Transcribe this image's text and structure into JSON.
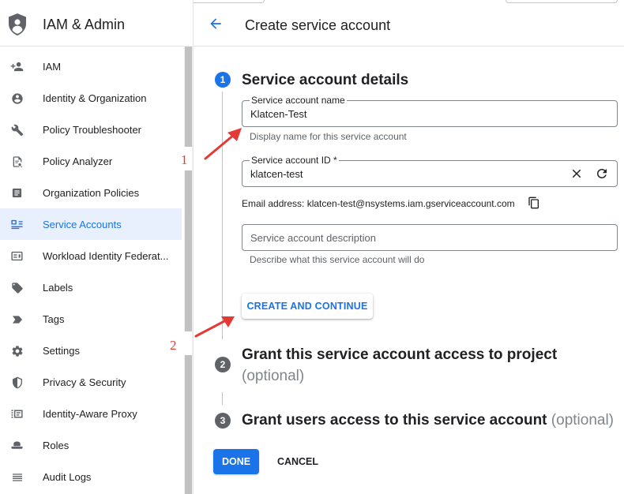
{
  "app": {
    "title": "IAM & Admin"
  },
  "sidebar": {
    "items": [
      {
        "label": "IAM",
        "icon": "person-add-icon"
      },
      {
        "label": "Identity & Organization",
        "icon": "account-circle-icon"
      },
      {
        "label": "Policy Troubleshooter",
        "icon": "wrench-icon"
      },
      {
        "label": "Policy Analyzer",
        "icon": "document-search-icon"
      },
      {
        "label": "Organization Policies",
        "icon": "list-document-icon"
      },
      {
        "label": "Service Accounts",
        "icon": "service-account-icon",
        "active": true
      },
      {
        "label": "Workload Identity Federat...",
        "icon": "id-card-icon"
      },
      {
        "label": "Labels",
        "icon": "label-tag-icon"
      },
      {
        "label": "Tags",
        "icon": "tag-chevron-icon"
      },
      {
        "label": "Settings",
        "icon": "gear-icon"
      },
      {
        "label": "Privacy & Security",
        "icon": "shield-icon"
      },
      {
        "label": "Identity-Aware Proxy",
        "icon": "proxy-icon"
      },
      {
        "label": "Roles",
        "icon": "hat-icon"
      },
      {
        "label": "Audit Logs",
        "icon": "list-lines-icon"
      }
    ]
  },
  "header": {
    "title": "Create service account"
  },
  "steps": {
    "step1": {
      "number": "1",
      "title": "Service account details",
      "name_field": {
        "label": "Service account name",
        "value": "Klatcen-Test",
        "helper": "Display name for this service account"
      },
      "id_field": {
        "label": "Service account ID *",
        "value": "klatcen-test"
      },
      "email": "Email address: klatcen-test@nsystems.iam.gserviceaccount.com",
      "description_field": {
        "placeholder": "Service account description",
        "helper": "Describe what this service account will do"
      },
      "continue_label": "CREATE AND CONTINUE"
    },
    "step2": {
      "number": "2",
      "title": "Grant this service account access to project",
      "optional": "(optional)"
    },
    "step3": {
      "number": "3",
      "title": "Grant users access to this service account",
      "optional": "(optional)"
    }
  },
  "actions": {
    "done": "DONE",
    "cancel": "CANCEL"
  },
  "annotations": {
    "one": "1",
    "two": "2"
  },
  "colors": {
    "accent": "#1a73e8",
    "annotation": "#e53935",
    "active_bg": "#e8f0fe"
  }
}
